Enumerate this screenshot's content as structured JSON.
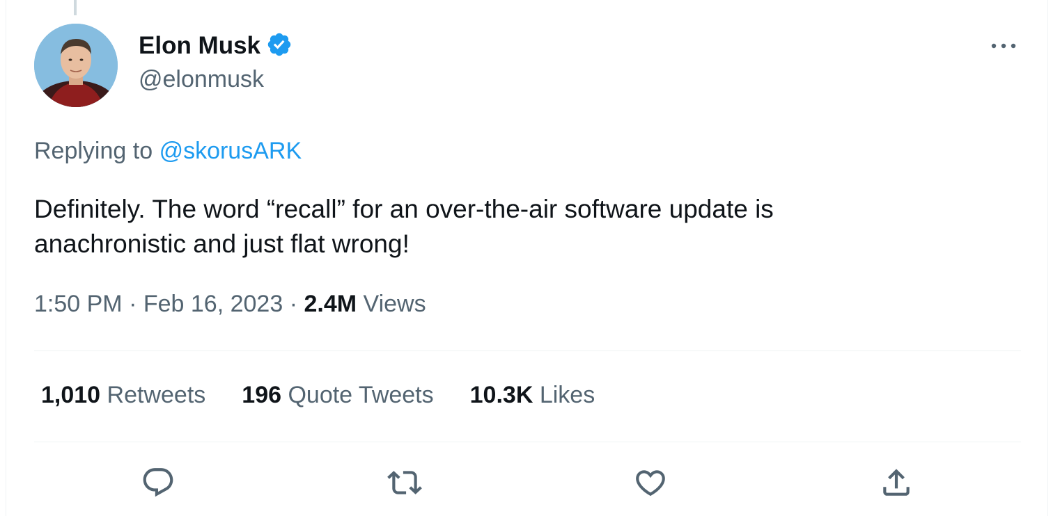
{
  "author": {
    "name": "Elon Musk",
    "handle": "@elonmusk",
    "verified_icon": "verified-badge-icon",
    "avatar_alt": "profile photo"
  },
  "reply": {
    "prefix": "Replying to",
    "mention": "@skorusARK"
  },
  "tweet": {
    "line1": "Definitely. The word “recall” for an over-the-air software update is",
    "line2": "anachronistic and just flat wrong!"
  },
  "meta": {
    "time": "1:50 PM",
    "date": "Feb 16, 2023",
    "views_count": "2.4M",
    "views_label": "Views",
    "separator": "·"
  },
  "stats": {
    "retweets_count": "1,010",
    "retweets_label": "Retweets",
    "quotes_count": "196",
    "quotes_label": "Quote Tweets",
    "likes_count": "10.3K",
    "likes_label": "Likes"
  },
  "actions": [
    "reply-icon",
    "retweet-icon",
    "like-icon",
    "share-icon"
  ],
  "colors": {
    "accent": "#1d9bf0",
    "text": "#0f1419",
    "muted": "#536471",
    "divider": "#eff3f4"
  }
}
